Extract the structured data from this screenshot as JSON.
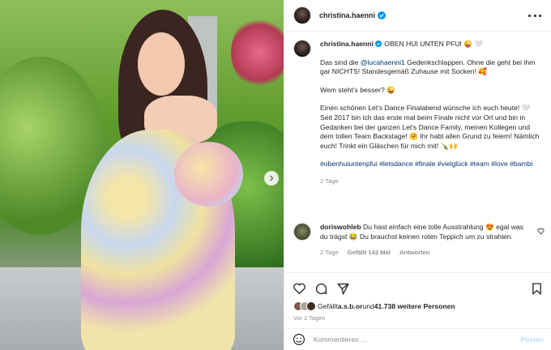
{
  "photo": {
    "alt_hidden": ""
  },
  "post": {
    "username": "christina.haenni",
    "caption": {
      "username": "christina.haenni",
      "line1_rest": " OBEN HUI UNTEN PFUI 😜 🤍",
      "para1_a": "Das sind die ",
      "para1_mention": "@lucahaenni1",
      "para1_b": " Gedenkschlappen. Ohne die geht bei ihm gar NICHTS! Standesgemäß Zuhause mit Socken! 🥰",
      "para2": "Wem steht's besser? 😜",
      "para3": "Einen schönen Let's Dance Finalabend wünsche ich euch heute! 🤍 Seit 2017 bin ich das erste mal beim Finale nicht vor Ort und bin in Gedanken bei der ganzen Let's Dance Family, meinen Kollegen und dem tollen Team Backstage! 🤗 Ihr habt allen Grund zu feiern! Nämlich euch! Trinkt ein Gläschen für mich mit! 🍾🙌",
      "hashtags": "#obenhuiuntenpfui #letsdance #finale #vielglück #team #love #bambi",
      "time": "2 Tage"
    },
    "comment": {
      "username": "doriswohleb",
      "text": " Du hast einfach eine tolle Ausstrahlung 😍 egal was du trägst 😂 Du brauchst keinen roten Teppich um zu strahlen.",
      "time": "2 Tage",
      "likes": "Gefällt 142 Mal",
      "reply": "Antworten"
    },
    "likes": {
      "prefix": "Gefällt ",
      "user": "a.s.b.or",
      "middle": " und ",
      "count": "41.738 weitere Personen"
    },
    "post_time": "Vor 2 Tagen",
    "comment_placeholder": "Kommentieren ...",
    "post_button": "Posten"
  },
  "icons": {
    "verified": "verified-badge-icon",
    "more": "more-options-icon",
    "next": "chevron-right-icon",
    "heart": "heart-icon",
    "comment": "comment-icon",
    "share": "share-icon",
    "bookmark": "bookmark-icon",
    "emoji": "emoji-icon"
  },
  "colors": {
    "link": "#00376b",
    "verified": "#0095f6",
    "muted": "#8e8e8e",
    "post_button": "#b2dffc"
  }
}
